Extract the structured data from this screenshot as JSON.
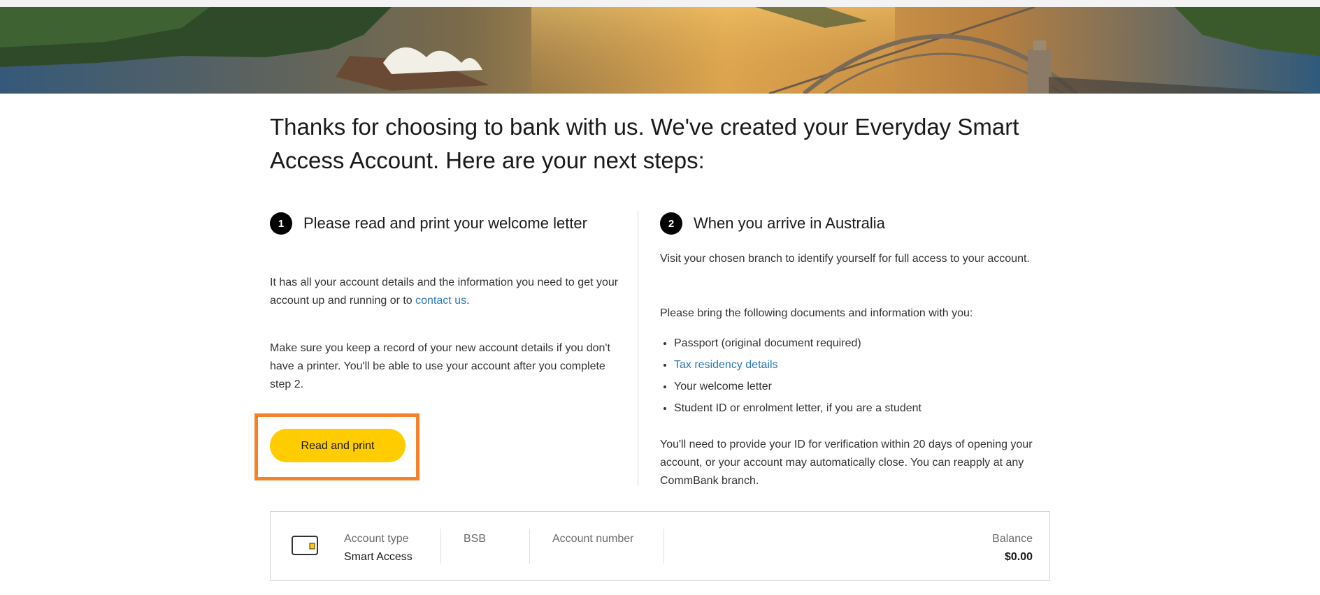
{
  "heading": "Thanks for choosing to bank with us. We've created your Everyday Smart Access Account. Here are your next steps:",
  "step1": {
    "number": "1",
    "title": "Please read and print your welcome letter",
    "para1_text": "It has all your account details and the information you need to get your account up and running or to ",
    "para1_link": "contact us",
    "para1_end": ".",
    "para2": "Make sure you keep a record of your new account details if you don't have a printer. You'll be able to use your account after you complete step 2.",
    "button_label": "Read and print"
  },
  "step2": {
    "number": "2",
    "title": "When you arrive in Australia",
    "para1": "Visit your chosen branch to identify yourself for full access to your account.",
    "para2": "Please bring the following documents and information with you:",
    "documents": [
      "Passport (original document required)",
      "Tax residency details",
      "Your welcome letter",
      "Student ID or enrolment letter, if you are a student"
    ],
    "para3": "You'll need to provide your ID for verification within 20 days of opening your account, or your account may automatically close. You can reapply at any CommBank branch."
  },
  "account": {
    "type_label": "Account type",
    "type_value": "Smart Access",
    "bsb_label": "BSB",
    "bsb_value": "",
    "number_label": "Account number",
    "number_value": "",
    "balance_label": "Balance",
    "balance_value": "$0.00"
  },
  "colors": {
    "button_yellow": "#ffcc00",
    "highlight_orange": "#f5822b",
    "link_blue": "#2a7ab8"
  }
}
